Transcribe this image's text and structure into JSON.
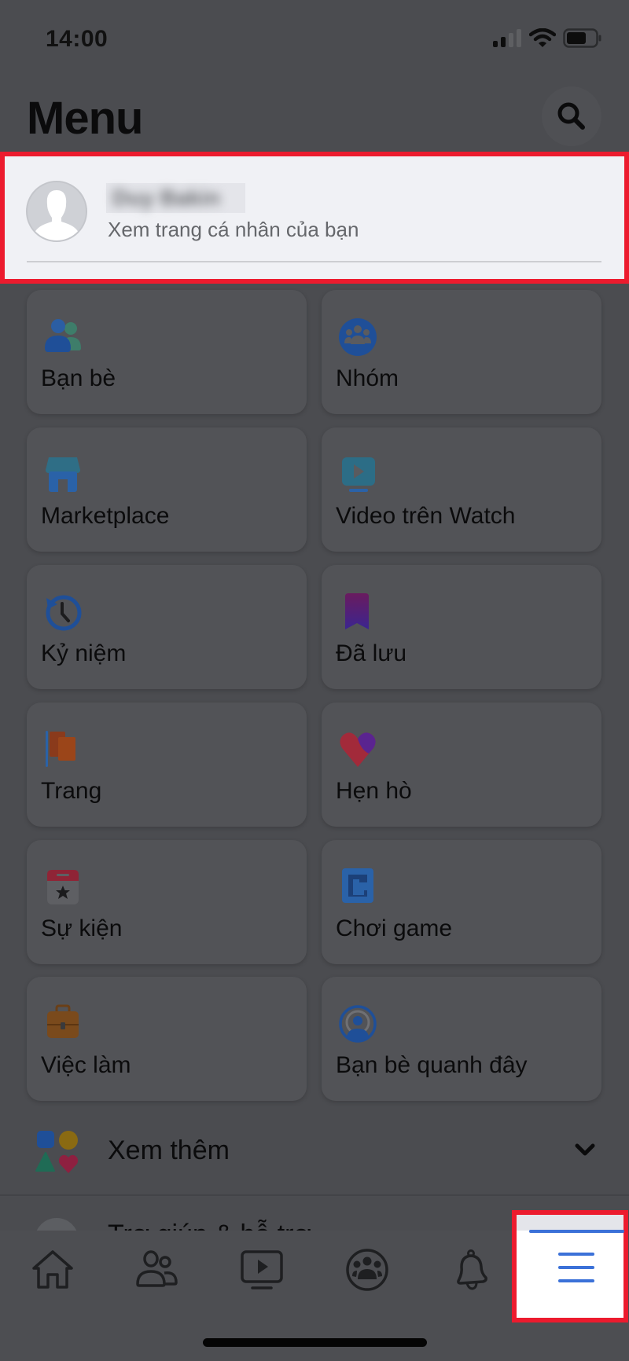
{
  "status_bar": {
    "time": "14:00",
    "icons": [
      "signal-icon",
      "wifi-icon",
      "battery-icon"
    ]
  },
  "header": {
    "title": "Menu",
    "search_icon": "search-icon"
  },
  "profile": {
    "name": "Duy Bakin",
    "name_obscured": true,
    "subtitle": "Xem trang cá nhân của bạn",
    "highlighted": true
  },
  "shortcuts": [
    {
      "label": "Bạn bè",
      "icon": "friends-icon"
    },
    {
      "label": "Nhóm",
      "icon": "groups-icon"
    },
    {
      "label": "Marketplace",
      "icon": "marketplace-icon"
    },
    {
      "label": "Video trên Watch",
      "icon": "watch-video-icon"
    },
    {
      "label": "Kỷ niệm",
      "icon": "memories-icon"
    },
    {
      "label": "Đã lưu",
      "icon": "saved-icon"
    },
    {
      "label": "Trang",
      "icon": "pages-icon"
    },
    {
      "label": "Hẹn hò",
      "icon": "dating-icon"
    },
    {
      "label": "Sự kiện",
      "icon": "events-icon"
    },
    {
      "label": "Chơi game",
      "icon": "gaming-icon"
    },
    {
      "label": "Việc làm",
      "icon": "jobs-icon"
    },
    {
      "label": "Bạn bè quanh đây",
      "icon": "nearby-friends-icon"
    }
  ],
  "see_more": {
    "label": "Xem thêm",
    "icon": "shapes-icon",
    "chevron": "chevron-down-icon"
  },
  "help_row": {
    "label": "Trợ giúp & hỗ trợ",
    "icon": "help-icon"
  },
  "tab_bar": {
    "tabs": [
      {
        "name": "home",
        "icon": "home-icon",
        "active": false
      },
      {
        "name": "friends",
        "icon": "friends-tab-icon",
        "active": false
      },
      {
        "name": "watch",
        "icon": "watch-tab-icon",
        "active": false
      },
      {
        "name": "groups",
        "icon": "groups-tab-icon",
        "active": false
      },
      {
        "name": "notifications",
        "icon": "bell-icon",
        "active": false
      },
      {
        "name": "menu",
        "icon": "hamburger-menu-icon",
        "active": true,
        "highlighted": true
      }
    ]
  },
  "colors": {
    "accent": "#3b71d8",
    "highlight_border": "#ec1b2e",
    "secondary_text": "#65676b"
  }
}
